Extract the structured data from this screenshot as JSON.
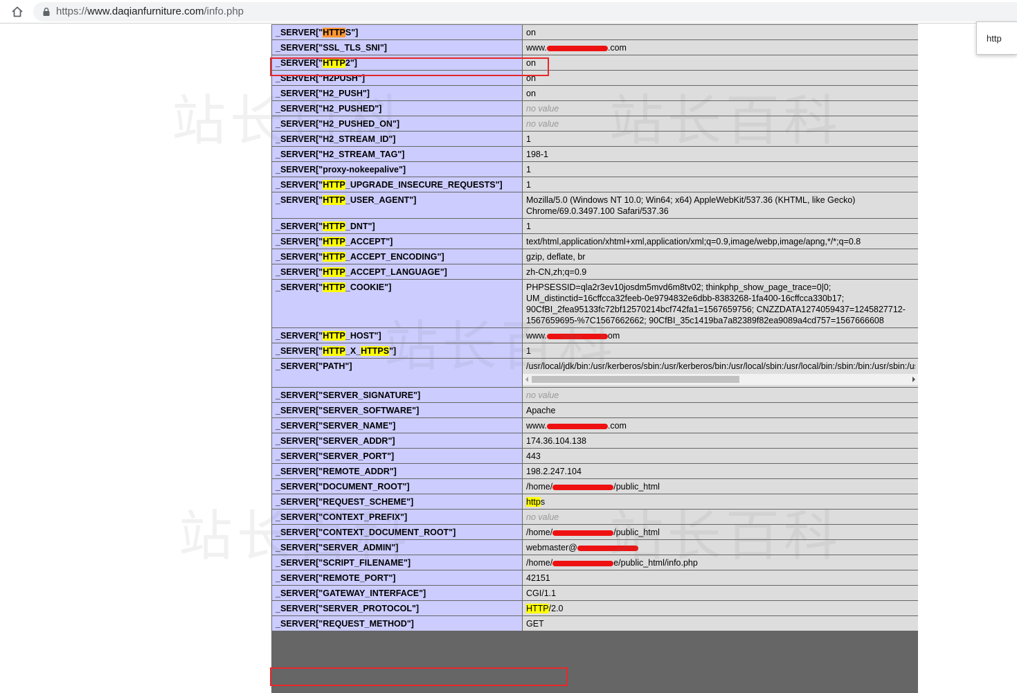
{
  "browser": {
    "url_prefix": "https://",
    "url_domain": "www.daqianfurniture.com",
    "url_path": "/info.php",
    "find_query": "http"
  },
  "colors": {
    "key_cell": "#ccccff",
    "value_cell": "#dddddd",
    "match_highlight": "#ffff00",
    "current_match": "#ff9632",
    "annotation_box": "#e8272a",
    "redaction": "#ee1111"
  },
  "rows": [
    {
      "key_pre": "_SERVER[\"",
      "key_hl": "HTTP",
      "key_hl_current": true,
      "key_mid": "S",
      "key_post": "\"]",
      "value": "on"
    },
    {
      "key": "_SERVER[\"SSL_TLS_SNI\"]",
      "value_pre": "www.",
      "value_redacted": true,
      "value_post": ".com"
    },
    {
      "key_pre": "_SERVER[\"",
      "key_hl": "HTTP",
      "key_post": "2\"]",
      "value": "on"
    },
    {
      "key": "_SERVER[\"H2PUSH\"]",
      "value": "on"
    },
    {
      "key": "_SERVER[\"H2_PUSH\"]",
      "value": "on"
    },
    {
      "key": "_SERVER[\"H2_PUSHED\"]",
      "value": "no value",
      "no_value": true
    },
    {
      "key": "_SERVER[\"H2_PUSHED_ON\"]",
      "value": "no value",
      "no_value": true
    },
    {
      "key": "_SERVER[\"H2_STREAM_ID\"]",
      "value": "1"
    },
    {
      "key": "_SERVER[\"H2_STREAM_TAG\"]",
      "value": "198-1"
    },
    {
      "key": "_SERVER[\"proxy-nokeepalive\"]",
      "value": "1"
    },
    {
      "key_pre": "_SERVER[\"",
      "key_hl": "HTTP",
      "key_post": "_UPGRADE_INSECURE_REQUESTS\"]",
      "value": "1"
    },
    {
      "key_pre": "_SERVER[\"",
      "key_hl": "HTTP",
      "key_post": "_USER_AGENT\"]",
      "value": "Mozilla/5.0 (Windows NT 10.0; Win64; x64) AppleWebKit/537.36 (KHTML, like Gecko) Chrome/69.0.3497.100 Safari/537.36"
    },
    {
      "key_pre": "_SERVER[\"",
      "key_hl": "HTTP",
      "key_post": "_DNT\"]",
      "value": "1"
    },
    {
      "key_pre": "_SERVER[\"",
      "key_hl": "HTTP",
      "key_post": "_ACCEPT\"]",
      "value": "text/html,application/xhtml+xml,application/xml;q=0.9,image/webp,image/apng,*/*;q=0.8"
    },
    {
      "key_pre": "_SERVER[\"",
      "key_hl": "HTTP",
      "key_post": "_ACCEPT_ENCODING\"]",
      "value": "gzip, deflate, br"
    },
    {
      "key_pre": "_SERVER[\"",
      "key_hl": "HTTP",
      "key_post": "_ACCEPT_LANGUAGE\"]",
      "value": "zh-CN,zh;q=0.9"
    },
    {
      "key_pre": "_SERVER[\"",
      "key_hl": "HTTP",
      "key_post": "_COOKIE\"]",
      "value": "PHPSESSID=qla2r3ev10josdm5mvd6m8tv02; thinkphp_show_page_trace=0|0; UM_distinctid=16cffcca32feeb-0e9794832e6dbb-8383268-1fa400-16cffcca330b17; 90CfBI_2fea95133fc72bf12570214bcf742fa1=1567659756; CNZZDATA1274059437=1245827712-1567659695-%7C1567662662; 90CfBI_35c1419ba7a82389f82ea9089a4cd757=1567666608"
    },
    {
      "key_pre": "_SERVER[\"",
      "key_hl": "HTTP",
      "key_post": "_HOST\"]",
      "value_pre": "www.",
      "value_redacted": true,
      "value_post": "om"
    },
    {
      "key_pre": "_SERVER[\"",
      "key_hl": "HTTP",
      "key_mid": "_X_",
      "key_hl2": "HTTPS",
      "key_post": "\"]",
      "value": "1"
    },
    {
      "key": "_SERVER[\"PATH\"]",
      "value": "/usr/local/jdk/bin:/usr/kerberos/sbin:/usr/kerberos/bin:/usr/local/sbin:/usr/local/bin:/sbin:/bin:/usr/sbin:/usr/bin",
      "scroll": true
    },
    {
      "key": "_SERVER[\"SERVER_SIGNATURE\"]",
      "value": "no value",
      "no_value": true
    },
    {
      "key": "_SERVER[\"SERVER_SOFTWARE\"]",
      "value": "Apache"
    },
    {
      "key": "_SERVER[\"SERVER_NAME\"]",
      "value_pre": "www.",
      "value_redacted": true,
      "value_post": ".com"
    },
    {
      "key": "_SERVER[\"SERVER_ADDR\"]",
      "value": "174.36.104.138"
    },
    {
      "key": "_SERVER[\"SERVER_PORT\"]",
      "value": "443"
    },
    {
      "key": "_SERVER[\"REMOTE_ADDR\"]",
      "value": "198.2.247.104"
    },
    {
      "key": "_SERVER[\"DOCUMENT_ROOT\"]",
      "value_pre": "/home/",
      "value_redacted": true,
      "value_post": "/public_html"
    },
    {
      "key": "_SERVER[\"REQUEST_SCHEME\"]",
      "value_hl": "http",
      "value_post": "s"
    },
    {
      "key": "_SERVER[\"CONTEXT_PREFIX\"]",
      "value": "no value",
      "no_value": true
    },
    {
      "key": "_SERVER[\"CONTEXT_DOCUMENT_ROOT\"]",
      "value_pre": "/home/",
      "value_redacted": true,
      "value_post": "/public_html"
    },
    {
      "key": "_SERVER[\"SERVER_ADMIN\"]",
      "value_pre": "webmaster@",
      "value_redacted": true,
      "value_post": ""
    },
    {
      "key": "_SERVER[\"SCRIPT_FILENAME\"]",
      "value_pre": "/home/",
      "value_redacted": true,
      "value_post": "e/public_html/info.php"
    },
    {
      "key": "_SERVER[\"REMOTE_PORT\"]",
      "value": "42151"
    },
    {
      "key": "_SERVER[\"GATEWAY_INTERFACE\"]",
      "value": "CGI/1.1"
    },
    {
      "key": "_SERVER[\"SERVER_PROTOCOL\"]",
      "value_hl": "HTTP",
      "value_post": "/2.0"
    },
    {
      "key": "_SERVER[\"REQUEST_METHOD\"]",
      "value": "GET"
    }
  ]
}
